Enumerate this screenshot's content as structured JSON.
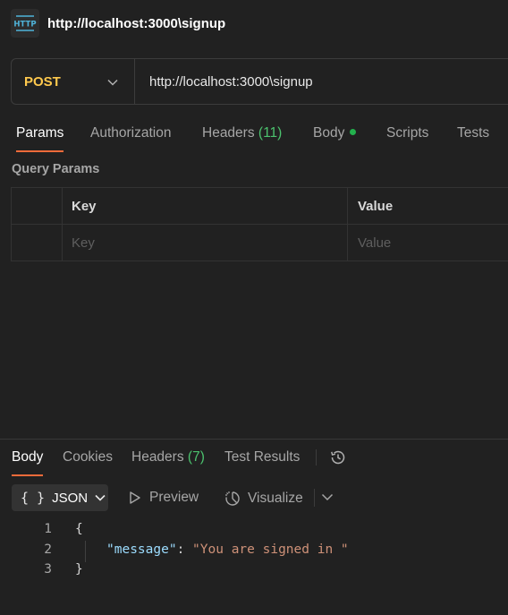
{
  "request": {
    "title": "http://localhost:3000\\signup",
    "method": "POST",
    "url": "http://localhost:3000\\signup",
    "icon": "http-icon"
  },
  "request_tabs": [
    {
      "label": "Params",
      "active": true
    },
    {
      "label": "Authorization"
    },
    {
      "label": "Headers",
      "count": "(11)"
    },
    {
      "label": "Body"
    },
    {
      "label": "Scripts"
    },
    {
      "label": "Tests"
    }
  ],
  "query_params": {
    "label": "Query Params",
    "columns": {
      "key": "Key",
      "value": "Value"
    },
    "placeholders": {
      "key": "Key",
      "value": "Value"
    }
  },
  "response_tabs": [
    {
      "label": "Body",
      "active": true
    },
    {
      "label": "Cookies"
    },
    {
      "label": "Headers",
      "count": "(7)"
    },
    {
      "label": "Test Results"
    }
  ],
  "response_toolbar": {
    "format": "JSON",
    "preview": "Preview",
    "visualize": "Visualize"
  },
  "response_body": {
    "line_numbers": [
      "1",
      "2",
      "3"
    ],
    "open_brace": "{",
    "key": "\"message\"",
    "colon": ": ",
    "value": "\"You are signed in \"",
    "close_brace": "}"
  },
  "colors": {
    "background": "#212121",
    "method": "#ffc94d",
    "active_tab_underline": "#f26b3a",
    "count": "#4cc26e",
    "body_dot": "#23b14d",
    "json_key": "#9cdcfe",
    "json_string": "#ce9178"
  }
}
